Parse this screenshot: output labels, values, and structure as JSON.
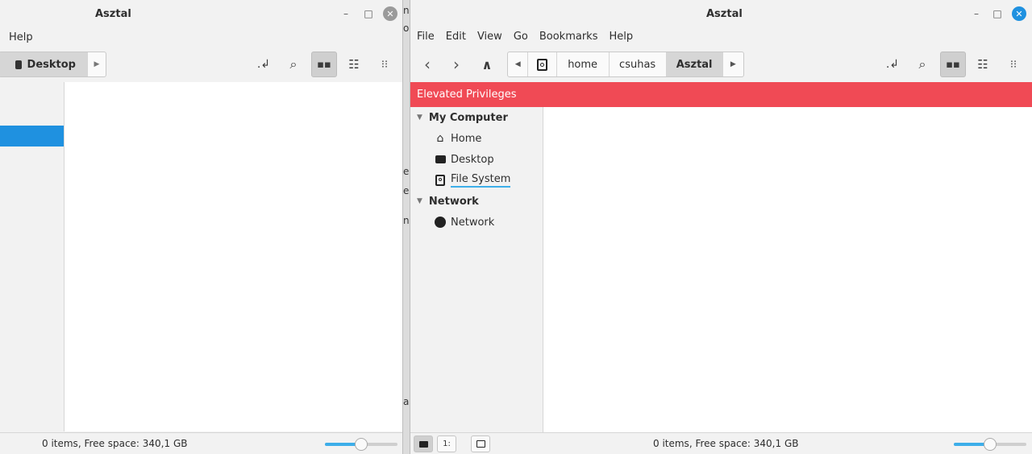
{
  "colors": {
    "accent": "#3daee9",
    "elevated_bar": "#f04a55",
    "close_button": "#1f91e0",
    "close_button_inactive": "#9a9a9a"
  },
  "back_window": {
    "title": "Asztal",
    "menu": [
      "Help"
    ],
    "breadcrumb": {
      "label": "Desktop"
    },
    "status": "0 items, Free space: 340,1 GB",
    "zoom_fraction": 0.5
  },
  "background_fragments": [
    "n",
    "o",
    "e.",
    "e",
    "n",
    "a"
  ],
  "front_window": {
    "title": "Asztal",
    "menu": [
      "File",
      "Edit",
      "View",
      "Go",
      "Bookmarks",
      "Help"
    ],
    "breadcrumbs": [
      "home",
      "csuhas",
      "Asztal"
    ],
    "elevated_label": "Elevated Privileges",
    "sidebar": {
      "my_computer": "My Computer",
      "home": "Home",
      "desktop": "Desktop",
      "file_system": "File System",
      "network_header": "Network",
      "network": "Network"
    },
    "status": "0 items, Free space: 340,1 GB",
    "zoom_fraction": 0.5
  }
}
